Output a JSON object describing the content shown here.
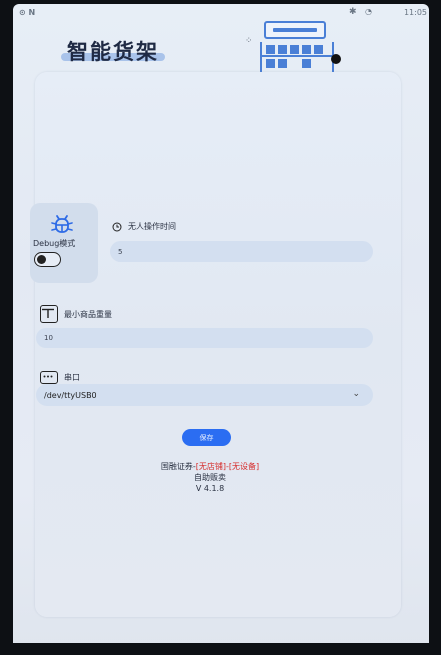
{
  "status_bar": {
    "left_text": "⊙ N",
    "time": "11:05",
    "bluetooth_icon": "bluetooth-icon",
    "wifi_icon": "wifi-icon"
  },
  "header": {
    "title": "智能货架",
    "illustration": "shelf-illustration-icon"
  },
  "settings": {
    "debug": {
      "icon": "bug-icon",
      "label": "Debug模式",
      "enabled": false
    },
    "idle_time": {
      "icon": "clock-icon",
      "label": "无人操作时间",
      "value": "5"
    },
    "min_weight": {
      "icon": "weight-icon",
      "label": "最小商品重量",
      "value": "10"
    },
    "serial_port": {
      "icon": "serial-port-icon",
      "label": "串口",
      "value": "/dev/ttyUSB0"
    },
    "save_label": "保存"
  },
  "footer": {
    "company": "国融证券-",
    "no_store": "[无店铺]",
    "dash": "-",
    "no_device": "[无设备]",
    "subtitle": "自助贩卖",
    "version": "V 4.1.8"
  },
  "colors": {
    "accent": "#2b6df2",
    "field_bg": "#d3dff0",
    "error_text": "#d62b2b",
    "title_underline": "#a9c3ea"
  }
}
